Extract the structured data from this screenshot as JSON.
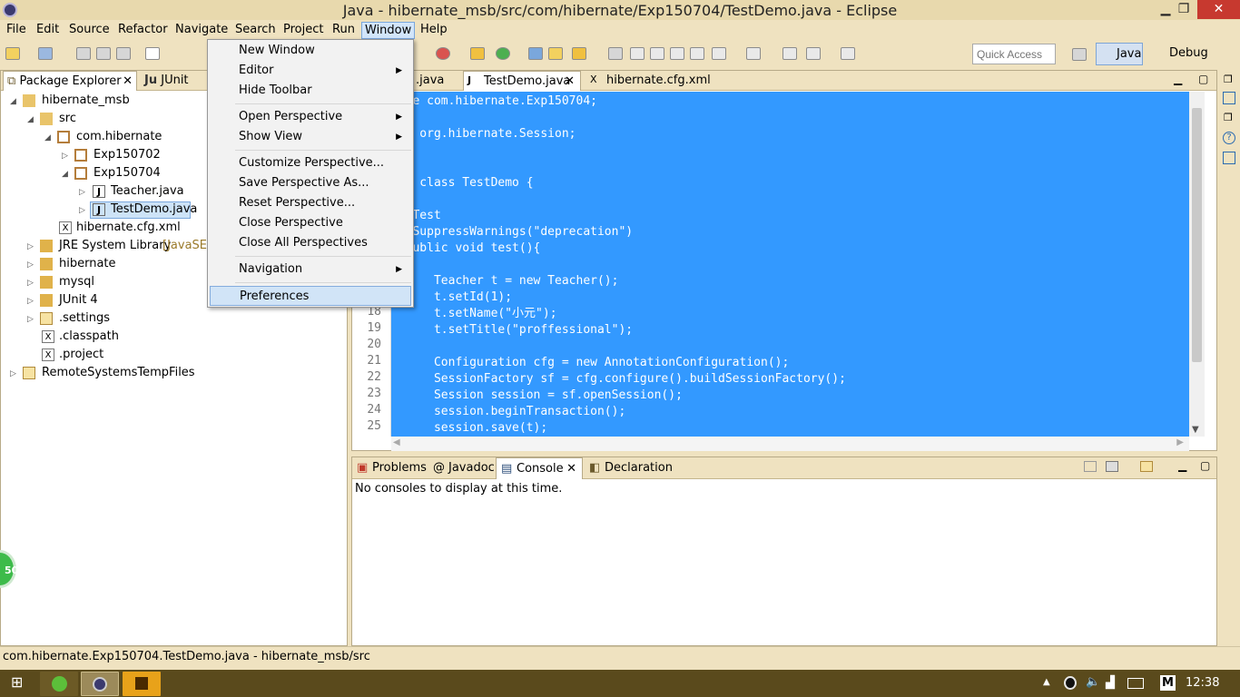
{
  "window": {
    "title": "Java - hibernate_msb/src/com/hibernate/Exp150704/TestDemo.java - Eclipse",
    "minimize": "▁",
    "restore": "❐",
    "close": "✕"
  },
  "menubar": [
    "File",
    "Edit",
    "Source",
    "Refactor",
    "Navigate",
    "Search",
    "Project",
    "Run",
    "Window",
    "Help"
  ],
  "toolbar": {
    "quick_access_placeholder": "Quick Access",
    "perspectives": [
      "Java",
      "Debug"
    ]
  },
  "window_menu": {
    "items": [
      {
        "label": "New Window",
        "submenu": false
      },
      {
        "label": "Editor",
        "submenu": true
      },
      {
        "label": "Hide Toolbar",
        "submenu": false
      },
      {
        "label": "Open Perspective",
        "submenu": true
      },
      {
        "label": "Show View",
        "submenu": true
      },
      {
        "label": "Customize Perspective...",
        "submenu": false
      },
      {
        "label": "Save Perspective As...",
        "submenu": false
      },
      {
        "label": "Reset Perspective...",
        "submenu": false
      },
      {
        "label": "Close Perspective",
        "submenu": false
      },
      {
        "label": "Close All Perspectives",
        "submenu": false
      },
      {
        "label": "Navigation",
        "submenu": true
      },
      {
        "label": "Preferences",
        "submenu": false,
        "highlighted": true
      }
    ],
    "submenu_arrow": "▶"
  },
  "package_explorer": {
    "tabs": [
      "Package Explorer",
      "JUnit"
    ],
    "tab_close": "✕",
    "tree": [
      {
        "label": "hibernate_msb",
        "expanded": true,
        "icon": "project-icon"
      },
      {
        "label": "src",
        "expanded": true,
        "icon": "source-folder-icon"
      },
      {
        "label": "com.hibernate",
        "expanded": true,
        "icon": "package-icon"
      },
      {
        "label": "Exp150702",
        "expanded": false,
        "icon": "package-icon"
      },
      {
        "label": "Exp150704",
        "expanded": true,
        "icon": "package-icon"
      },
      {
        "label": "Teacher.java",
        "expanded": false,
        "icon": "java-file-icon"
      },
      {
        "label": "TestDemo.java",
        "expanded": false,
        "icon": "java-file-icon",
        "selected": true
      },
      {
        "label": "hibernate.cfg.xml",
        "expanded": null,
        "icon": "xml-file-icon"
      },
      {
        "label": "JRE System Library",
        "suffix": "[JavaSE-",
        "expanded": false,
        "icon": "library-icon"
      },
      {
        "label": "hibernate",
        "expanded": false,
        "icon": "library-icon"
      },
      {
        "label": "mysql",
        "expanded": false,
        "icon": "library-icon"
      },
      {
        "label": "JUnit 4",
        "expanded": false,
        "icon": "library-icon"
      },
      {
        "label": ".settings",
        "expanded": false,
        "icon": "folder-icon"
      },
      {
        "label": ".classpath",
        "expanded": null,
        "icon": "xml-file-icon"
      },
      {
        "label": ".project",
        "expanded": null,
        "icon": "xml-file-icon"
      },
      {
        "label": "RemoteSystemsTempFiles",
        "expanded": false,
        "icon": "folder-icon"
      }
    ]
  },
  "editor": {
    "tabs": [
      ".java",
      "TestDemo.java",
      "hibernate.cfg.xml"
    ],
    "line_numbers": [
      "",
      "",
      "",
      "",
      "",
      "",
      "",
      "",
      "",
      "",
      "",
      "",
      "",
      "18",
      "19",
      "20",
      "21",
      "22",
      "23",
      "24",
      "25"
    ],
    "code": [
      {
        "text": "kage com.hibernate.Exp150704;"
      },
      {
        "text": ""
      },
      {
        "text": "ort org.hibernate.Session;"
      },
      {
        "text": ""
      },
      {
        "text": ""
      },
      {
        "text": "lic class TestDemo {"
      },
      {
        "text": ""
      },
      {
        "text": "  @Test"
      },
      {
        "text": "  @SuppressWarnings(\"deprecation\")"
      },
      {
        "text": "  public void test(){"
      },
      {
        "text": ""
      },
      {
        "text": "      Teacher t = new Teacher();"
      },
      {
        "text": "      t.setId(1);"
      },
      {
        "text": "      t.setName(\"小元\");"
      },
      {
        "text": "      t.setTitle(\"proffessional\");"
      },
      {
        "text": ""
      },
      {
        "text": "      Configuration cfg = new AnnotationConfiguration();"
      },
      {
        "text": "      SessionFactory sf = cfg.configure().buildSessionFactory();"
      },
      {
        "text": "      Session session = sf.openSession();"
      },
      {
        "text": "      session.beginTransaction();"
      },
      {
        "text": "      session.save(t);"
      }
    ]
  },
  "console_view": {
    "tabs": [
      "Problems",
      "Javadoc",
      "Console",
      "Declaration"
    ],
    "message": "No consoles to display at this time."
  },
  "statusbar": {
    "text": "com.hibernate.Exp150704.TestDemo.java - hibernate_msb/src"
  },
  "taskbar": {
    "clock": "12:38",
    "badge": "50",
    "tray_m": "M"
  },
  "colors": {
    "selection": "#3399ff",
    "chrome": "#efe2c0",
    "menu_highlight": "#d1e4f7"
  }
}
